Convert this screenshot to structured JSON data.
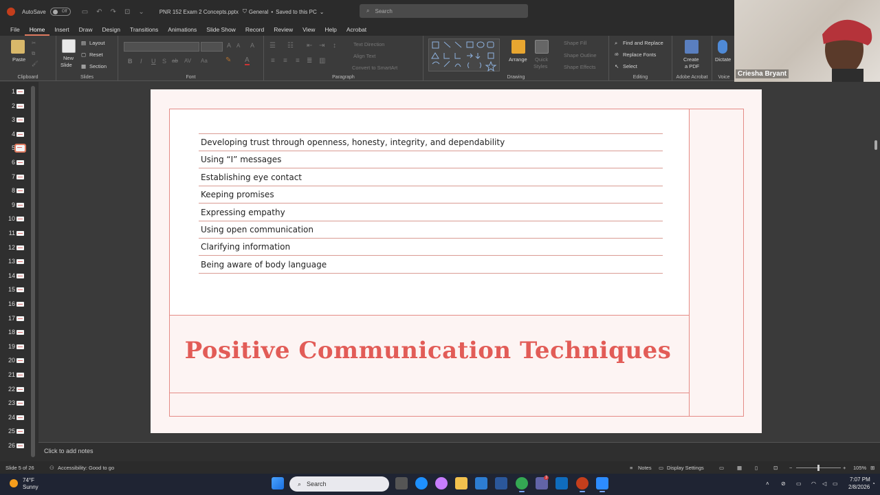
{
  "titlebar": {
    "autosave_label": "AutoSave",
    "autosave_state": "Off",
    "document_name": "PNR 152 Exam 2 Concepts.pptx",
    "sensitivity": "General",
    "save_status": "Saved to this PC",
    "search_placeholder": "Search"
  },
  "ribbon_tabs": [
    "File",
    "Home",
    "Insert",
    "Draw",
    "Design",
    "Transitions",
    "Animations",
    "Slide Show",
    "Record",
    "Review",
    "View",
    "Help",
    "Acrobat"
  ],
  "ribbon": {
    "clipboard": {
      "paste": "Paste",
      "label": "Clipboard"
    },
    "slides": {
      "new_slide": "New",
      "new_slide2": "Slide",
      "layout": "Layout",
      "reset": "Reset",
      "section": "Section",
      "label": "Slides"
    },
    "font": {
      "label": "Font",
      "bold": "B",
      "italic": "I",
      "underline": "U",
      "strike": "S",
      "shadow": "ab",
      "spacing": "AV",
      "case": "Aa"
    },
    "paragraph": {
      "label": "Paragraph",
      "text_direction": "Text Direction",
      "align_text": "Align Text",
      "smartart": "Convert to SmartArt"
    },
    "drawing": {
      "label": "Drawing",
      "arrange": "Arrange",
      "quick_styles": "Quick",
      "quick_styles2": "Styles",
      "shape_fill": "Shape Fill",
      "shape_outline": "Shape Outline",
      "shape_effects": "Shape Effects"
    },
    "editing": {
      "label": "Editing",
      "find_replace": "Find and Replace",
      "replace_fonts": "Replace Fonts",
      "select": "Select"
    },
    "acrobat": {
      "label": "Adobe Acrobat",
      "create_pdf": "Create",
      "create_pdf2": "a PDF"
    },
    "voice": {
      "label": "Voice",
      "dictate": "Dictate"
    }
  },
  "webcam": {
    "participant_name": "Criesha Bryant"
  },
  "thumbnails": [
    "1",
    "2",
    "3",
    "4",
    "5",
    "6",
    "7",
    "8",
    "9",
    "10",
    "11",
    "12",
    "13",
    "14",
    "15",
    "16",
    "17",
    "18",
    "19",
    "20",
    "21",
    "22",
    "23",
    "24",
    "25",
    "26"
  ],
  "active_slide_index": 5,
  "slide": {
    "items": [
      "Developing trust through openness, honesty, integrity, and dependability",
      "Using “I” messages",
      "Establishing eye contact",
      "Keeping promises",
      "Expressing empathy",
      "Using open communication",
      "Clarifying information",
      "Being aware of body language"
    ],
    "title": "Positive Communication Techniques",
    "accent_color": "#e25c57"
  },
  "notes": {
    "placeholder": "Click to add notes"
  },
  "statusbar": {
    "slide_indicator": "Slide 5 of 26",
    "accessibility": "Accessibility: Good to go",
    "notes": "Notes",
    "display_settings": "Display Settings",
    "zoom": "105%"
  },
  "taskbar": {
    "temperature": "74°F",
    "condition": "Sunny",
    "search": "Search",
    "time": "7:07 PM",
    "date": "2/8/2026",
    "badge": "3"
  }
}
